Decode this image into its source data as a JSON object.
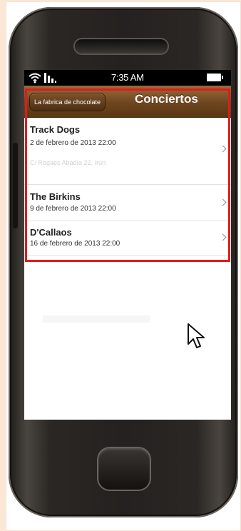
{
  "status_bar": {
    "time": "7:35 AM",
    "icons": [
      "wifi-icon",
      "signal-icon",
      "battery-icon"
    ]
  },
  "nav": {
    "back_label": "La fabrica de chocolate",
    "title": "Conciertos"
  },
  "concerts": [
    {
      "name": "Track Dogs",
      "date": "2 de febrero de 2013 22:00",
      "venue": "C/ Regaes Abadía 22, Irún"
    },
    {
      "name": "The Birkins",
      "date": "9 de febrero de 2013 22:00"
    },
    {
      "name": "D'Callaos",
      "date": "16 de febrero de 2013 22:00"
    }
  ],
  "colors": {
    "nav_bar": "#6d4620",
    "highlight": "#e01b1b",
    "background": "#fbe7d6"
  }
}
